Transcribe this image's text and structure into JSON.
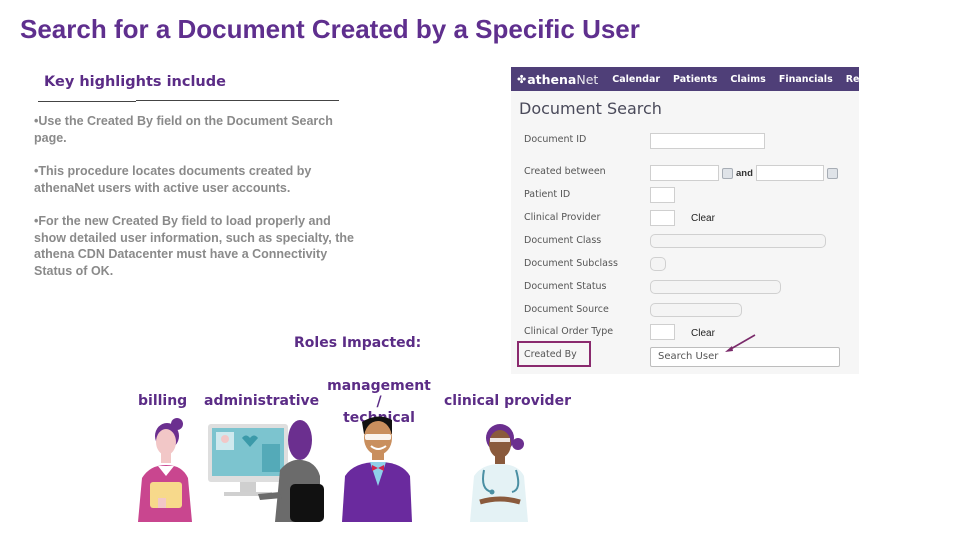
{
  "slide": {
    "title": "Search for a Document Created by a Specific User",
    "highlights_heading": "Key highlights include",
    "bullets": [
      "•Use the Created By field on the Document Search page.",
      "•This procedure locates documents created by athenaNet users with active user accounts.",
      "•For the new Created By field to load properly and show detailed user information, such as specialty, the athena CDN Datacenter must have a Connectivity Status of OK."
    ],
    "roles_heading": "Roles Impacted:",
    "roles": [
      {
        "label": "billing",
        "icon": "billing-person-icon"
      },
      {
        "label": "administrative",
        "icon": "administrative-person-icon"
      },
      {
        "label": "management / technical",
        "line1": "management /",
        "line2": "technical",
        "icon": "management-person-icon"
      },
      {
        "label": "clinical provider",
        "icon": "clinical-provider-icon"
      }
    ]
  },
  "app": {
    "logo_bold": "athena",
    "logo_regular": "Net",
    "nav": [
      "Calendar",
      "Patients",
      "Claims",
      "Financials",
      "Reports"
    ],
    "page_title": "Document Search",
    "fields": {
      "document_id": "Document ID",
      "created_between": "Created between",
      "and": "and",
      "patient_id": "Patient ID",
      "clinical_provider": "Clinical Provider",
      "document_class": "Document Class",
      "document_subclass": "Document Subclass",
      "document_status": "Document Status",
      "document_source": "Document Source",
      "clinical_order_type": "Clinical Order Type",
      "created_by": "Created By"
    },
    "clear_label": "Clear",
    "search_user_placeholder": "Search User"
  },
  "colors": {
    "brand_purple": "#5f2f8e",
    "nav_bg": "#4f3f78",
    "highlight_border": "#8a2a6e",
    "bullet_text": "#8a8a8a"
  }
}
